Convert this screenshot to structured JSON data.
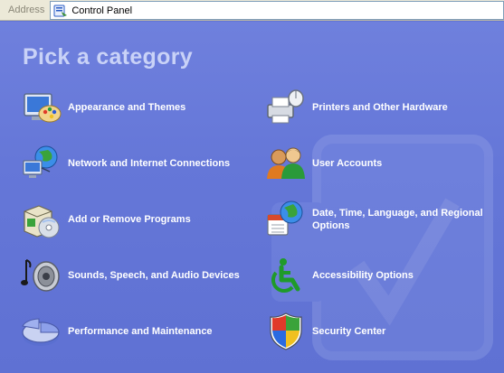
{
  "address_bar": {
    "label": "Address",
    "value": "Control Panel",
    "icon": "control-panel-icon"
  },
  "title": "Pick a category",
  "categories": [
    {
      "label": "Appearance and Themes",
      "icon": "appearance-themes-icon"
    },
    {
      "label": "Printers and Other Hardware",
      "icon": "printer-mouse-icon"
    },
    {
      "label": "Network and Internet Connections",
      "icon": "network-globe-icon"
    },
    {
      "label": "User Accounts",
      "icon": "users-icon"
    },
    {
      "label": "Add or Remove Programs",
      "icon": "install-box-cd-icon"
    },
    {
      "label": "Date, Time, Language, and Regional Options",
      "icon": "calendar-globe-icon"
    },
    {
      "label": "Sounds, Speech, and Audio Devices",
      "icon": "speaker-note-icon"
    },
    {
      "label": "Accessibility Options",
      "icon": "wheelchair-icon"
    },
    {
      "label": "Performance and Maintenance",
      "icon": "pie-chart-icon"
    },
    {
      "label": "Security Center",
      "icon": "shield-icon"
    }
  ],
  "colors": {
    "panel_background": "#6375d6",
    "title_color": "#c9d2f7",
    "label_color": "#ffffff"
  }
}
